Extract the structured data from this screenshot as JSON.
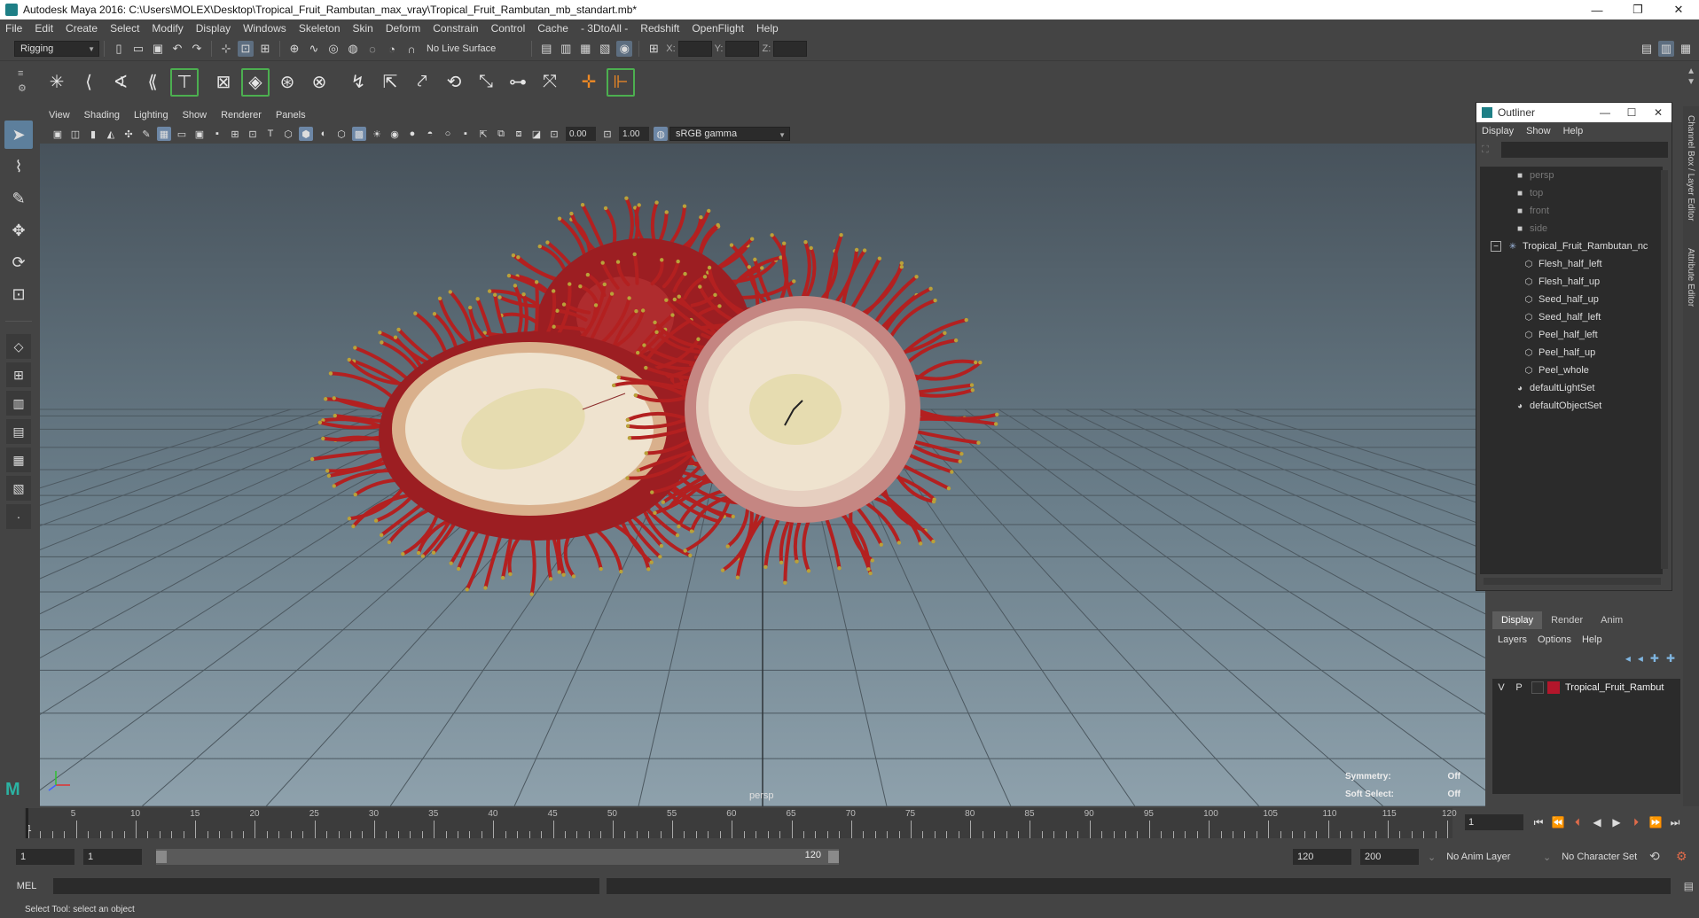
{
  "window": {
    "title": "Autodesk Maya 2016: C:\\Users\\MOLEX\\Desktop\\Tropical_Fruit_Rambutan_max_vray\\Tropical_Fruit_Rambutan_mb_standart.mb*",
    "minimize": "—",
    "restore": "❐",
    "close": "✕"
  },
  "menubar": [
    "File",
    "Edit",
    "Create",
    "Select",
    "Modify",
    "Display",
    "Windows",
    "Skeleton",
    "Skin",
    "Deform",
    "Constrain",
    "Control",
    "Cache",
    "- 3DtoAll -",
    "Redshift",
    "OpenFlight",
    "Help"
  ],
  "statusline": {
    "menuset": "Rigging",
    "live_surface": "No Live Surface",
    "x_label": "X:",
    "y_label": "Y:",
    "z_label": "Z:"
  },
  "panel": {
    "menus": [
      "View",
      "Shading",
      "Lighting",
      "Show",
      "Renderer",
      "Panels"
    ],
    "exposure": "0.00",
    "gamma": "1.00",
    "color_space": "sRGB gamma"
  },
  "viewport": {
    "camera": "persp",
    "symmetry_label": "Symmetry:",
    "symmetry_value": "Off",
    "soft_select_label": "Soft Select:",
    "soft_select_value": "Off",
    "colors": {
      "peel": "#9c1e22",
      "spike": "#b32020",
      "spike_tip": "#b9a23a",
      "flesh": "#efe3cf",
      "seed": "#e6dcb0"
    }
  },
  "outliner": {
    "title": "Outliner",
    "menus": [
      "Display",
      "Show",
      "Help"
    ],
    "cameras": [
      "persp",
      "top",
      "front",
      "side"
    ],
    "group": "Tropical_Fruit_Rambutan_nc",
    "children": [
      "Flesh_half_left",
      "Flesh_half_up",
      "Seed_half_up",
      "Seed_half_left",
      "Peel_half_left",
      "Peel_half_up",
      "Peel_whole"
    ],
    "sets": [
      "defaultLightSet",
      "defaultObjectSet"
    ]
  },
  "righttabs": [
    "Channel Box / Layer Editor",
    "Attribute Editor"
  ],
  "layer_editor": {
    "tabs": [
      "Display",
      "Render",
      "Anim"
    ],
    "menus": [
      "Layers",
      "Options",
      "Help"
    ],
    "layer": {
      "v": "V",
      "p": "P",
      "name": "Tropical_Fruit_Rambut",
      "color": "#b3162b"
    }
  },
  "timeline": {
    "start_label": "1",
    "ticks": [
      5,
      10,
      15,
      20,
      25,
      30,
      35,
      40,
      45,
      50,
      55,
      60,
      65,
      70,
      75,
      80,
      85,
      90,
      95,
      100,
      105,
      110,
      115,
      120
    ],
    "current_frame": "1"
  },
  "range": {
    "start": "1",
    "playback_start": "1",
    "range_start": "1",
    "range_end": "120",
    "playback_end": "120",
    "end": "200",
    "anim_layer": "No Anim Layer",
    "character_set": "No Character Set"
  },
  "commandline": {
    "label": "MEL"
  },
  "helpline": {
    "text": "Select Tool: select an object"
  }
}
